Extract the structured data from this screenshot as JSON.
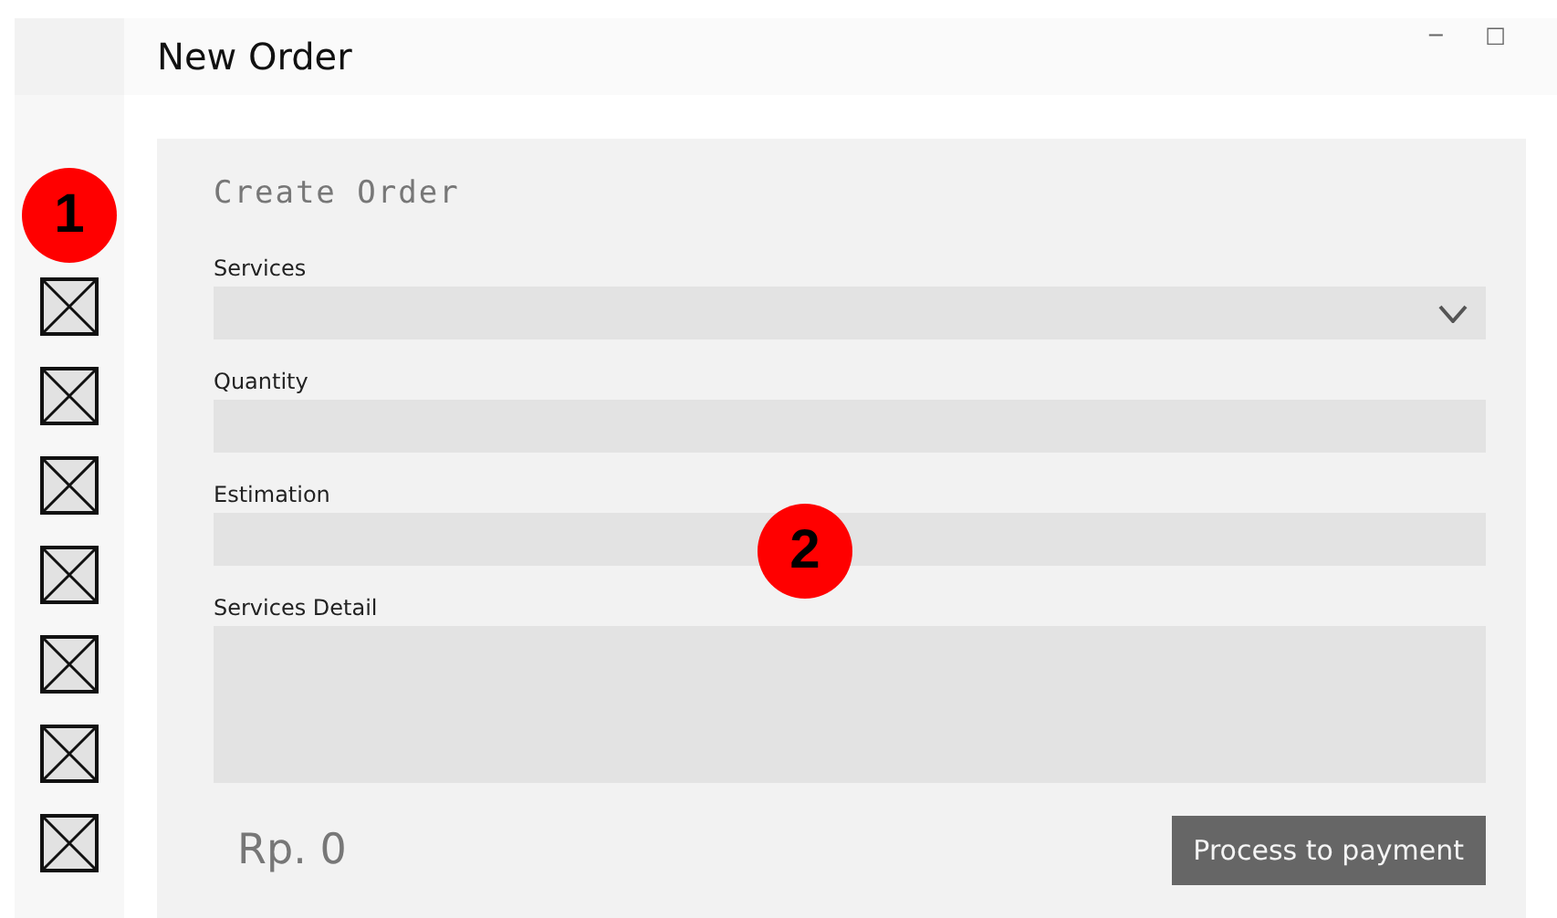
{
  "window": {
    "title": "New Order",
    "controls": [
      "−",
      "□"
    ]
  },
  "sidebar": {
    "items": [
      {
        "kind": "placeholder"
      },
      {
        "kind": "placeholder"
      },
      {
        "kind": "placeholder"
      },
      {
        "kind": "placeholder"
      },
      {
        "kind": "placeholder"
      },
      {
        "kind": "placeholder"
      },
      {
        "kind": "placeholder"
      }
    ]
  },
  "form": {
    "title": "Create Order",
    "fields": [
      {
        "label": "Services",
        "kind": "select"
      },
      {
        "label": "Quantity",
        "kind": "text"
      },
      {
        "label": "Estimation",
        "kind": "text"
      },
      {
        "label": "Services Detail",
        "kind": "textarea"
      }
    ],
    "total": "Rp. 0",
    "submit": "Process to payment"
  },
  "annotations": [
    "1",
    "2"
  ]
}
